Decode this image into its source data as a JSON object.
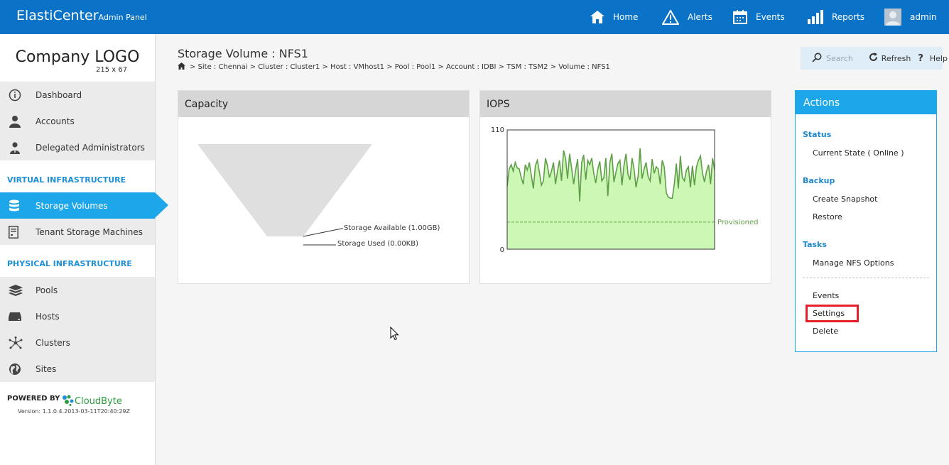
{
  "header": {
    "brand": "ElastiCenter",
    "brand_sub": "Admin Panel",
    "nav": [
      {
        "label": "Home",
        "icon": "home-icon"
      },
      {
        "label": "Alerts",
        "icon": "warning-icon"
      },
      {
        "label": "Events",
        "icon": "calendar-icon"
      },
      {
        "label": "Reports",
        "icon": "bar-chart-icon"
      },
      {
        "label": "admin",
        "icon": "avatar"
      }
    ]
  },
  "sidebar": {
    "logo": "Company LOGO",
    "logo_size": "215 x 67",
    "top_items": [
      {
        "label": "Dashboard",
        "icon": "info-icon"
      },
      {
        "label": "Accounts",
        "icon": "user-icon"
      },
      {
        "label": "Delegated Administrators",
        "icon": "admin-user-icon"
      }
    ],
    "virtual_heading": "VIRTUAL INFRASTRUCTURE",
    "virtual_items": [
      {
        "label": "Storage Volumes",
        "icon": "database-icon",
        "active": true
      },
      {
        "label": "Tenant Storage Machines",
        "icon": "server-icon"
      }
    ],
    "physical_heading": "PHYSICAL INFRASTRUCTURE",
    "physical_items": [
      {
        "label": "Pools",
        "icon": "layers-icon"
      },
      {
        "label": "Hosts",
        "icon": "host-icon"
      },
      {
        "label": "Clusters",
        "icon": "cluster-icon"
      },
      {
        "label": "Sites",
        "icon": "globe-icon"
      }
    ],
    "powered_by": "POWERED BY",
    "powered_brand": "CloudByte",
    "version": "Version: 1.1.0.4.2013-03-11T20:40:29Z"
  },
  "page": {
    "title": "Storage Volume : NFS1",
    "breadcrumb": "> Site : Chennai > Cluster : Cluster1 > Host : VMhost1 > Pool : Pool1 > Account : IDBI > TSM : TSM2 > Volume : NFS1"
  },
  "toolbar": {
    "search_placeholder": "Search",
    "refresh": "Refresh",
    "help": "Help"
  },
  "capacity": {
    "title": "Capacity",
    "available_label": "Storage Available (1.00GB)",
    "used_label": "Storage Used (0.00KB)"
  },
  "iops": {
    "title": "IOPS",
    "provisioned_label": "Provisioned"
  },
  "chart_data": {
    "type": "area",
    "title": "IOPS",
    "ylim": [
      0,
      110
    ],
    "y_ticks": [
      "110",
      "0"
    ],
    "provisioned": 25,
    "colors": {
      "line": "#5f9e48",
      "fill": "#ccf7b4",
      "provisioned": "#5f9e48"
    },
    "values": [
      58,
      74,
      78,
      72,
      80,
      75,
      74,
      66,
      60,
      78,
      73,
      80,
      68,
      56,
      77,
      82,
      71,
      59,
      63,
      84,
      77,
      66,
      72,
      80,
      60,
      72,
      82,
      63,
      91,
      84,
      65,
      88,
      75,
      60,
      73,
      83,
      44,
      80,
      87,
      64,
      82,
      78,
      84,
      70,
      61,
      74,
      81,
      63,
      66,
      84,
      49,
      80,
      88,
      62,
      71,
      79,
      82,
      59,
      77,
      88,
      69,
      64,
      84,
      74,
      57,
      67,
      93,
      65,
      74,
      80,
      67,
      63,
      83,
      70,
      76,
      74,
      60,
      82,
      76,
      52,
      48,
      47,
      47,
      60,
      79,
      56,
      86,
      66,
      63,
      73,
      76,
      57,
      77,
      59,
      76,
      82,
      86,
      70,
      62,
      72,
      78,
      60,
      84,
      73
    ]
  },
  "actions": {
    "title": "Actions",
    "status_heading": "Status",
    "current_state": "Current State ( Online )",
    "backup_heading": "Backup",
    "create_snapshot": "Create Snapshot",
    "restore": "Restore",
    "tasks_heading": "Tasks",
    "manage_nfs": "Manage NFS Options",
    "events": "Events",
    "settings": "Settings",
    "delete": "Delete"
  }
}
